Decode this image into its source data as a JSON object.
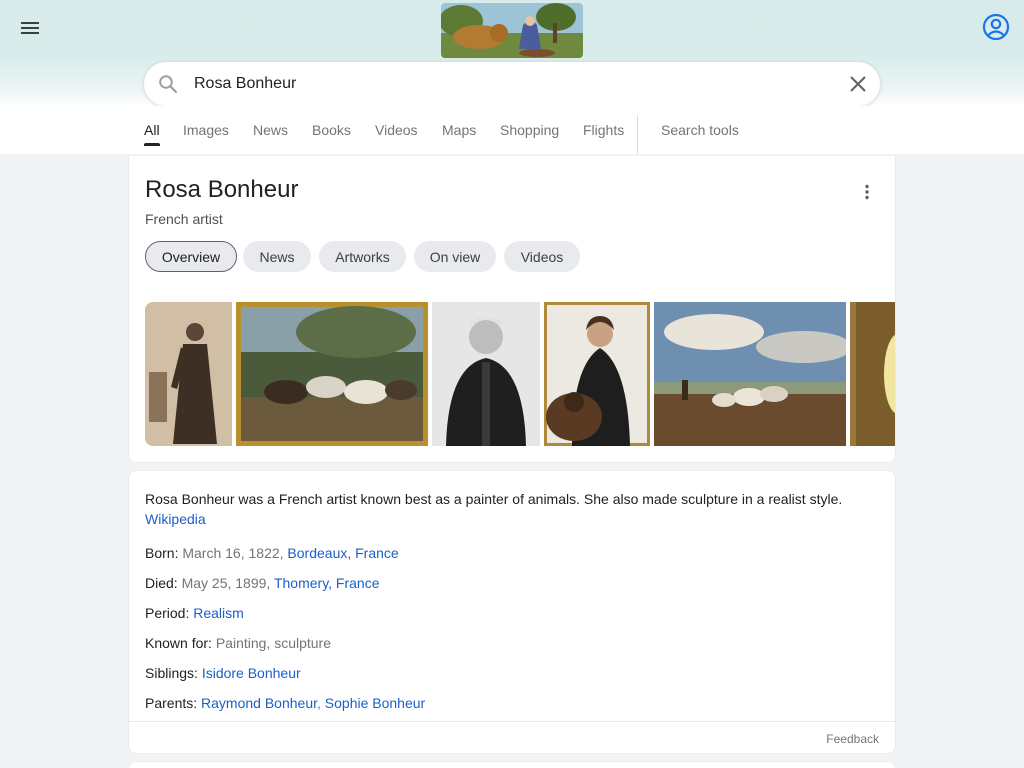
{
  "header": {
    "menu_icon": "hamburger-menu-icon",
    "account_icon": "account-circle-icon",
    "doodle_alt": "Rosa Bonheur doodle"
  },
  "search": {
    "query": "Rosa Bonheur",
    "search_icon": "search-icon",
    "clear_icon": "close-icon"
  },
  "tabs": [
    {
      "label": "All",
      "active": true
    },
    {
      "label": "Images"
    },
    {
      "label": "News"
    },
    {
      "label": "Books"
    },
    {
      "label": "Videos"
    },
    {
      "label": "Maps"
    },
    {
      "label": "Shopping"
    },
    {
      "label": "Flights"
    }
  ],
  "search_tools_label": "Search tools",
  "knowledge_panel": {
    "title": "Rosa Bonheur",
    "subtitle": "French artist",
    "chips": [
      {
        "label": "Overview",
        "active": true
      },
      {
        "label": "News"
      },
      {
        "label": "Artworks"
      },
      {
        "label": "On view"
      },
      {
        "label": "Videos"
      }
    ],
    "description": "Rosa Bonheur was a French artist known best as a painter of animals. She also made sculpture in a realist style.",
    "source": "Wikipedia",
    "facts": {
      "born": {
        "label": "Born:",
        "value": "March 16, 1822,",
        "link": "Bordeaux, France"
      },
      "died": {
        "label": "Died:",
        "value": "May 25, 1899,",
        "link": "Thomery, France"
      },
      "period": {
        "label": "Period:",
        "link": "Realism"
      },
      "known_for": {
        "label": "Known for:",
        "value": "Painting, sculpture"
      },
      "siblings": {
        "label": "Siblings:",
        "link": "Isidore Bonheur"
      },
      "parents": {
        "label": "Parents:",
        "link1": "Raymond Bonheur",
        "sep": ",",
        "link2": "Sophie Bonheur"
      }
    },
    "feedback": "Feedback"
  },
  "colors": {
    "link": "#1a5fc8",
    "text": "#202124",
    "muted": "#70757a",
    "header_bg": "#d7ebea"
  }
}
